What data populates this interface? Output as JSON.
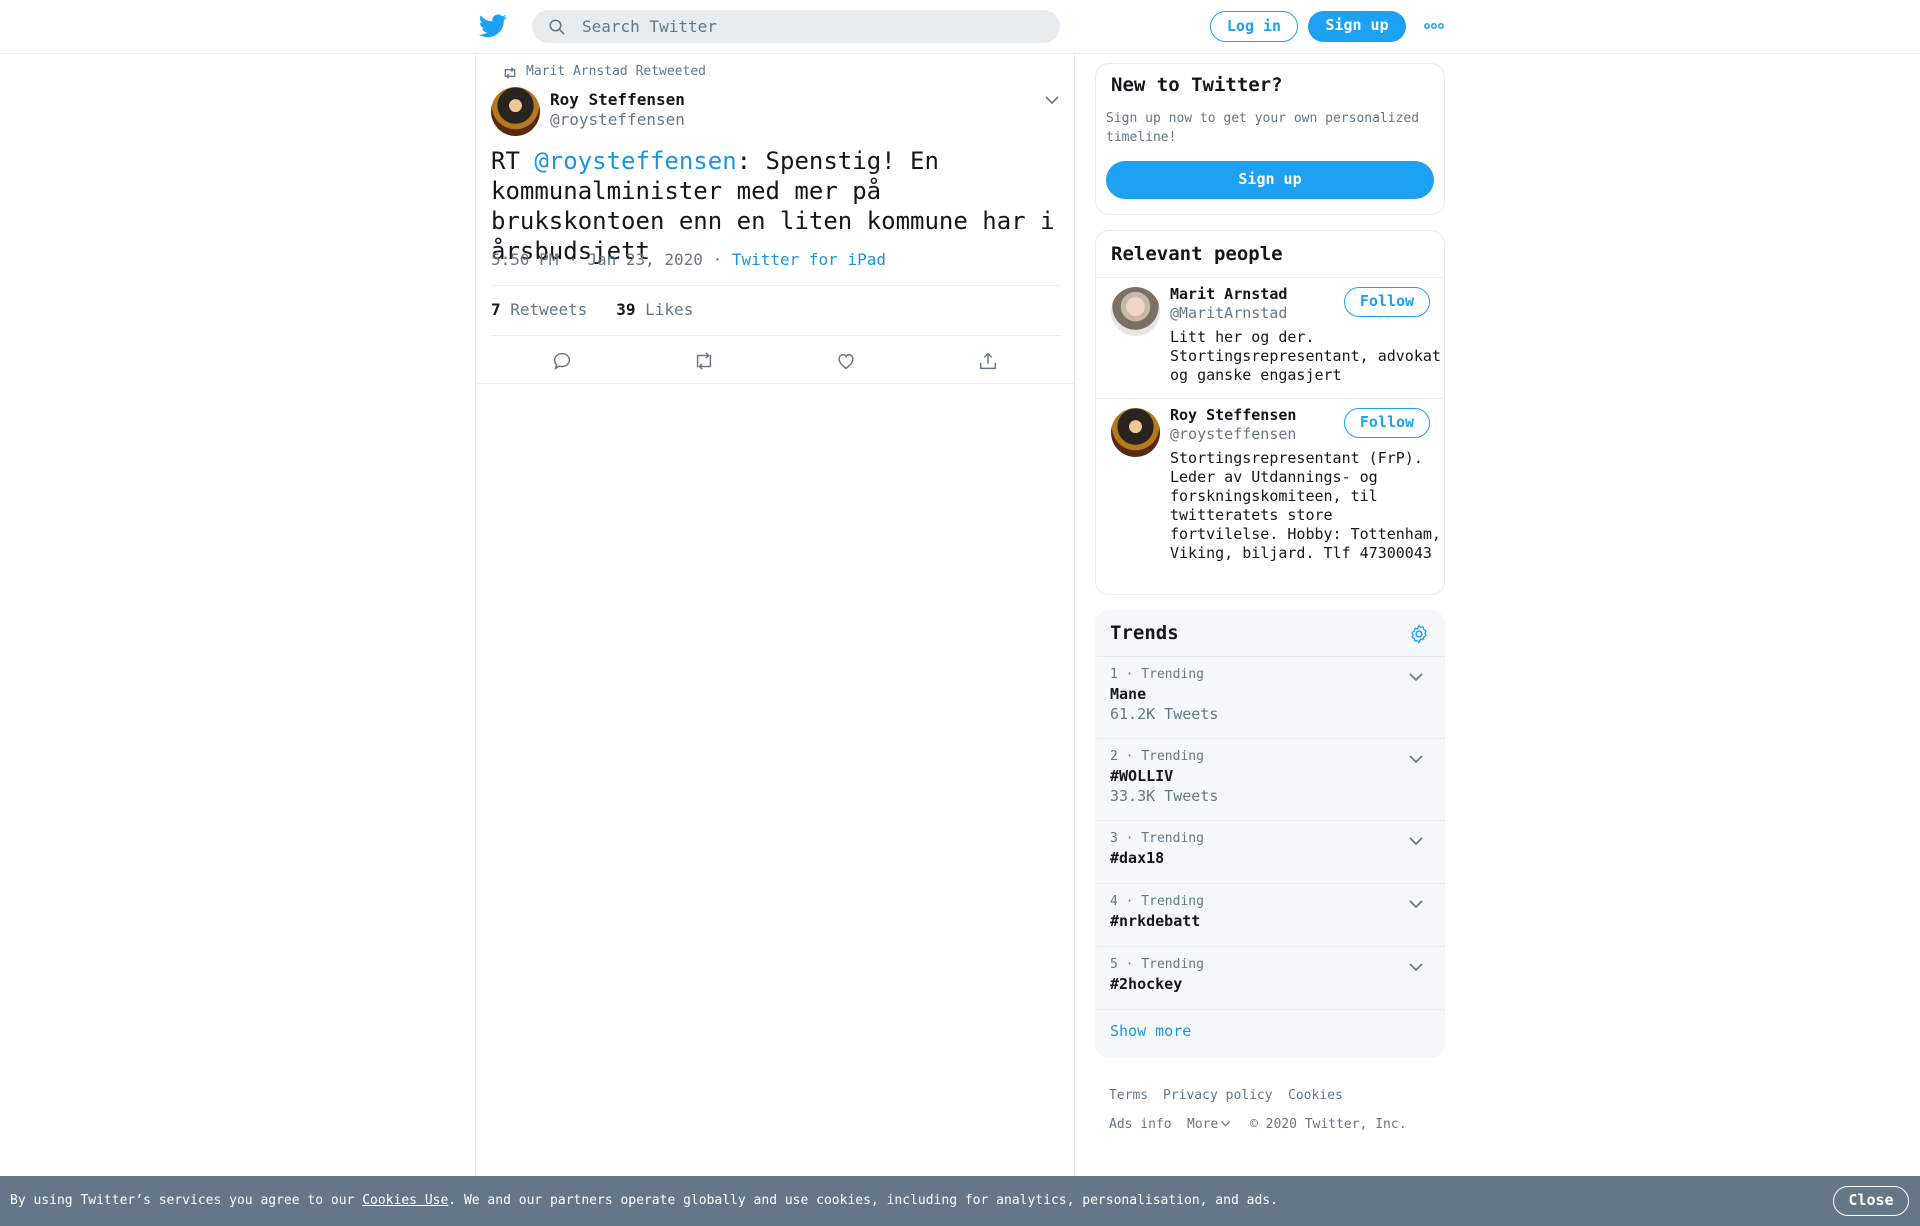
{
  "header": {
    "search_placeholder": "Search Twitter",
    "login_label": "Log in",
    "signup_label": "Sign up",
    "accent": "#1da1f2"
  },
  "tweet": {
    "retweeted_by": "Marit Arnstad Retweeted",
    "author_name": "Roy Steffensen",
    "author_handle": "@roysteffensen",
    "text_prefix": "RT ",
    "mention": "@roysteffensen",
    "text_body": ": Spenstig! En kommunalminister med mer på brukskontoen enn en liten kommune har i årsbudsjett",
    "time": "5:50 PM · Jan 23, 2020",
    "separator": "·",
    "source": "Twitter for iPad",
    "retweets_count": "7",
    "retweets_label": "Retweets",
    "likes_count": "39",
    "likes_label": "Likes"
  },
  "new_to_twitter": {
    "title": "New to Twitter?",
    "description": "Sign up now to get your own personalized timeline!",
    "signup_label": "Sign up"
  },
  "relevant_people": {
    "title": "Relevant people",
    "people": [
      {
        "name": "Marit Arnstad",
        "handle": "@MaritArnstad",
        "bio": "Litt her og der. Stortingsrepresentant, advokat og ganske engasjert",
        "follow_label": "Follow"
      },
      {
        "name": "Roy Steffensen",
        "handle": "@roysteffensen",
        "bio": "Stortingsrepresentant (FrP). Leder av Utdannings- og forskningskomiteen, til twitteratets store fortvilelse. Hobby: Tottenham, Viking, biljard. Tlf 47300043",
        "follow_label": "Follow"
      }
    ]
  },
  "trends": {
    "title": "Trends",
    "items": [
      {
        "meta": "1 · Trending",
        "name": "Mane",
        "count": "61.2K Tweets"
      },
      {
        "meta": "2 · Trending",
        "name": "#WOLLIV",
        "count": "33.3K Tweets"
      },
      {
        "meta": "3 · Trending",
        "name": "#dax18",
        "count": ""
      },
      {
        "meta": "4 · Trending",
        "name": "#nrkdebatt",
        "count": ""
      },
      {
        "meta": "5 · Trending",
        "name": "#2hockey",
        "count": ""
      }
    ],
    "show_more": "Show more"
  },
  "footer": {
    "terms": "Terms",
    "privacy": "Privacy policy",
    "cookies": "Cookies",
    "ads_info": "Ads info",
    "more": "More",
    "copyright": "© 2020 Twitter, Inc."
  },
  "cookie_bar": {
    "prefix": "By using Twitter’s services you agree to our ",
    "link": "Cookies Use",
    "suffix": ". We and our partners operate globally and use cookies, including for analytics, personalisation, and ads.",
    "close_label": "Close"
  }
}
